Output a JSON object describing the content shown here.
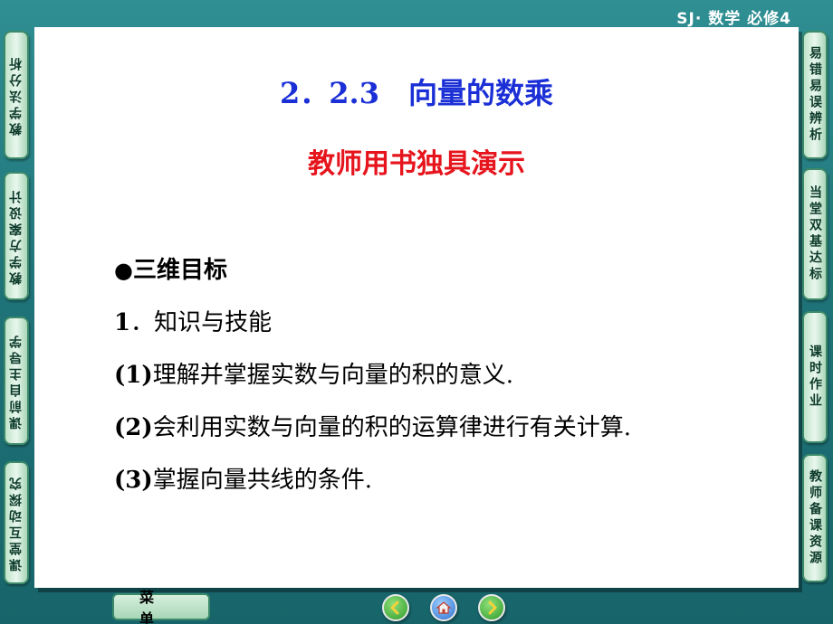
{
  "header": {
    "brand": "SJ· 数学  必修4"
  },
  "slide": {
    "title": "2．2.3　向量的数乘",
    "subtitle": "教师用书独具演示",
    "bullet_symbol": "●",
    "section": "三维目标",
    "items": [
      {
        "num": "1",
        "text": "．知识与技能"
      },
      {
        "num": "(1)",
        "text": "理解并掌握实数与向量的积的意义."
      },
      {
        "num": "(2)",
        "text": "会利用实数与向量的积的运算律进行有关计算."
      },
      {
        "num": "(3)",
        "text": "掌握向量共线的条件."
      }
    ]
  },
  "left_tabs": [
    "教学法分析",
    "教学方案设计",
    "课前自主导学",
    "课堂互动探究"
  ],
  "right_tabs": [
    "易错易误辨析",
    "当堂双基达标",
    "课时作业",
    "教师备课资源"
  ],
  "footer": {
    "menu_label": "菜单",
    "prev_icon": "arrow-left-icon",
    "home_icon": "home-icon",
    "next_icon": "arrow-right-icon"
  },
  "colors": {
    "title": "#1b2fd6",
    "subtitle": "#e6141d",
    "background": "#1f7479"
  }
}
